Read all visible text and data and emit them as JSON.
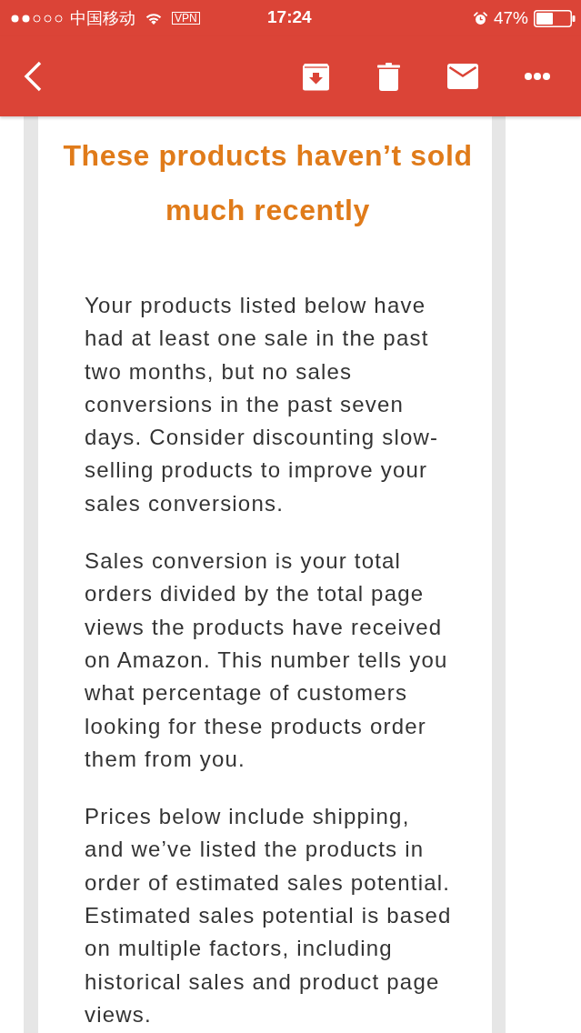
{
  "status_bar": {
    "carrier": "中国移动",
    "vpn": "VPN",
    "time": "17:24",
    "battery": "47%"
  },
  "email": {
    "heading": "These products haven’t sold much recently",
    "paragraphs": [
      "Your products listed below have had at least one sale in the past two months, but no sales conversions in the past seven days. Consider discounting slow-selling products to improve your sales conversions.",
      "Sales conversion is your total orders divided by the total page views the products have received on Amazon. This number tells you what percentage of customers looking for these products order them from you.",
      "Prices below include shipping, and we’ve listed the products in order of estimated sales potential. Estimated sales potential is based on multiple factors, including historical sales and product page views."
    ]
  }
}
